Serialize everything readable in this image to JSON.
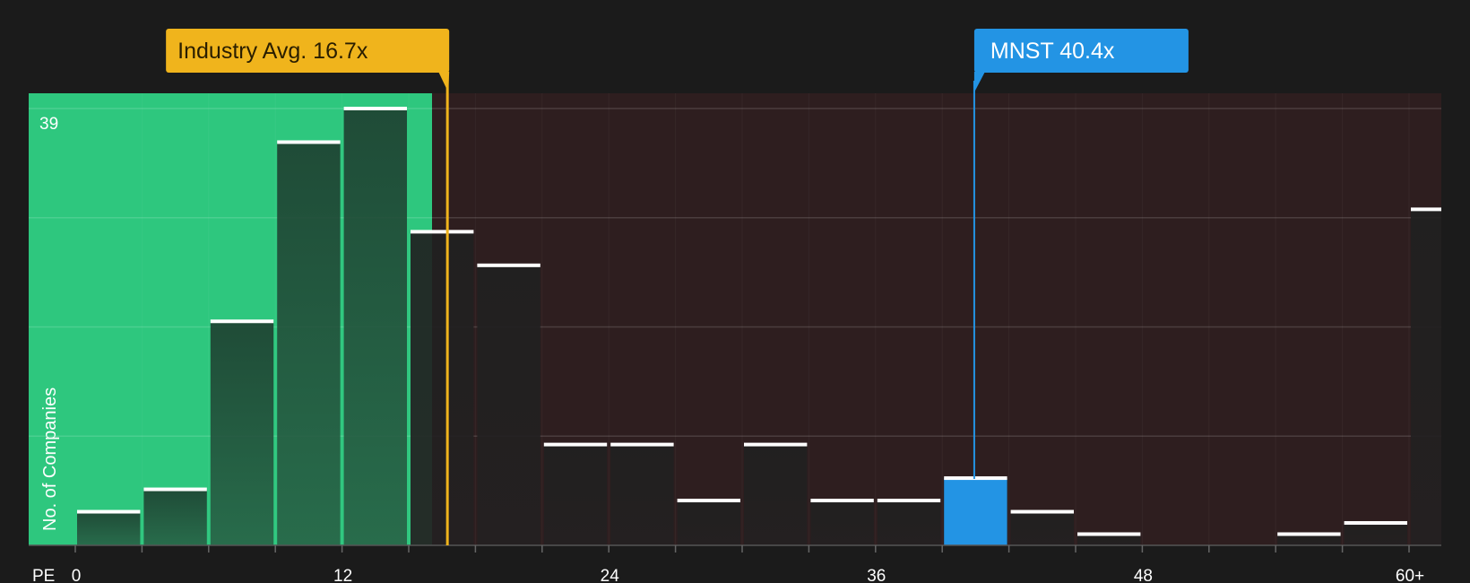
{
  "chart_data": {
    "type": "bar",
    "xlabel": "PE",
    "ylabel": "No. of Companies",
    "y_max_label": "39",
    "ylim": [
      0,
      39
    ],
    "bin_width": 3,
    "x_ticks": [
      {
        "value": 0,
        "label": "0"
      },
      {
        "value": 12,
        "label": "12"
      },
      {
        "value": 24,
        "label": "24"
      },
      {
        "value": 36,
        "label": "36"
      },
      {
        "value": 48,
        "label": "48"
      },
      {
        "value": 60,
        "label": "60+"
      }
    ],
    "bins": [
      {
        "start": 0,
        "count": 3
      },
      {
        "start": 3,
        "count": 5
      },
      {
        "start": 6,
        "count": 20
      },
      {
        "start": 9,
        "count": 36
      },
      {
        "start": 12,
        "count": 39
      },
      {
        "start": 15,
        "count": 28
      },
      {
        "start": 18,
        "count": 25
      },
      {
        "start": 21,
        "count": 9
      },
      {
        "start": 24,
        "count": 9
      },
      {
        "start": 27,
        "count": 4
      },
      {
        "start": 30,
        "count": 9
      },
      {
        "start": 33,
        "count": 4
      },
      {
        "start": 36,
        "count": 4
      },
      {
        "start": 39,
        "count": 6
      },
      {
        "start": 42,
        "count": 3
      },
      {
        "start": 45,
        "count": 1
      },
      {
        "start": 48,
        "count": 0
      },
      {
        "start": 51,
        "count": 0
      },
      {
        "start": 54,
        "count": 1
      },
      {
        "start": 57,
        "count": 2
      },
      {
        "start": 60,
        "count": 30
      }
    ],
    "highlight_bin_start": 39,
    "industry_avg": {
      "value": 16.7,
      "label": "Industry Avg. 16.7x"
    },
    "company": {
      "ticker": "MNST",
      "value": 40.4,
      "label": "MNST 40.4x"
    },
    "colors": {
      "background": "#1b1b1b",
      "undervalued_zone": "#2ec77e",
      "overvalued_zone": "#2e1e1f",
      "industry_marker": "#f0b41c",
      "company_marker": "#2394e4",
      "bar_cap": "#ffffff"
    }
  }
}
